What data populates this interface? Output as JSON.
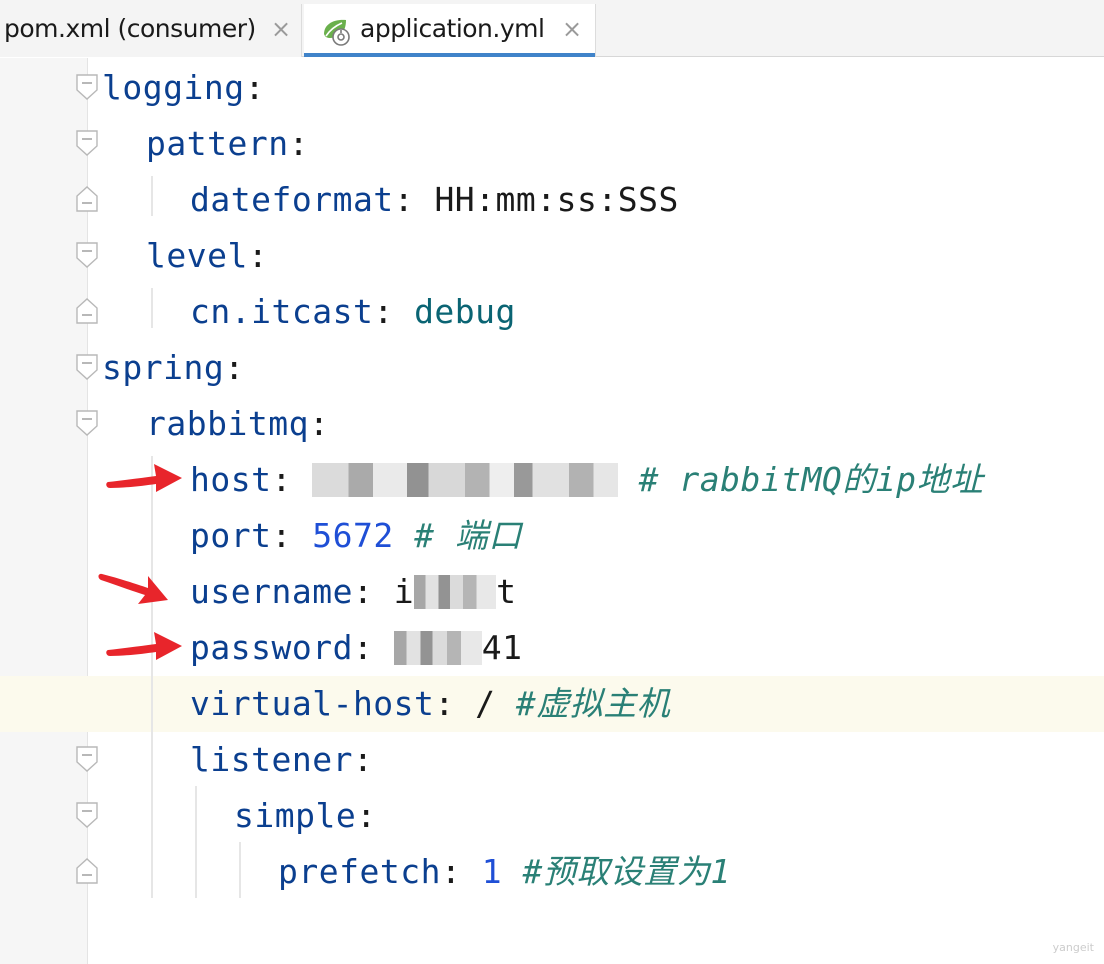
{
  "tabs": [
    {
      "label": "pom.xml (consumer)",
      "close": "×",
      "icon": "none",
      "active": false
    },
    {
      "label": "application.yml",
      "close": "×",
      "icon": "spring-leaf-icon",
      "active": true
    }
  ],
  "code": {
    "logging_key": "logging",
    "pattern_key": "pattern",
    "dateformat_key": "dateformat",
    "dateformat_value": "HH:mm:ss:SSS",
    "level_key": "level",
    "cn_itcast_key": "cn.itcast",
    "cn_itcast_value": "debug",
    "spring_key": "spring",
    "rabbitmq_key": "rabbitmq",
    "host_key": "host",
    "host_comment": "# rabbitMQ的ip地址",
    "port_key": "port",
    "port_value": "5672",
    "port_comment": "# 端口",
    "username_key": "username",
    "username_value_start": "i",
    "username_value_end": "t",
    "password_key": "password",
    "password_value_end": "41",
    "virtual_host_key": "virtual-host",
    "virtual_host_value": "/",
    "virtual_host_comment": "#虚拟主机",
    "listener_key": "listener",
    "simple_key": "simple",
    "prefetch_key": "prefetch",
    "prefetch_value": "1",
    "prefetch_comment": "#预取设置为1",
    "colon": ":"
  },
  "annotations": {
    "arrow_color": "#e8252b",
    "arrows": [
      "host-line-arrow",
      "username-line-arrow",
      "password-line-arrow"
    ]
  },
  "colors": {
    "key": "#0b3f8f",
    "number": "#1f4fd6",
    "keyword_value": "#0a6473",
    "comment": "#2a8076",
    "caret_line": "#fcfaed",
    "active_tab_underline": "#4083c9"
  },
  "watermark": "yangeit"
}
